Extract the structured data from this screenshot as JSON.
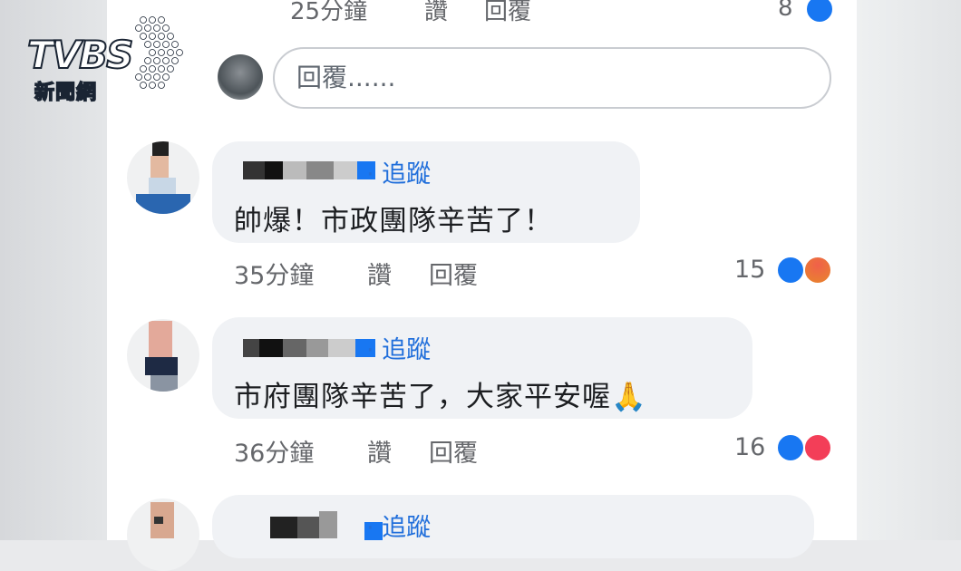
{
  "logo": {
    "brand": "TVBS",
    "sub": "新聞網"
  },
  "top_row": {
    "time": "25分鐘",
    "like_label": "讚",
    "reply_label": "回覆",
    "count": "8"
  },
  "reply_box": {
    "placeholder": "回覆......"
  },
  "comments": [
    {
      "follow": "追蹤",
      "text": "帥爆！市政團隊辛苦了！",
      "time": "35分鐘",
      "like_label": "讚",
      "reply_label": "回覆",
      "reactions_count": "15",
      "reactions": [
        "like-icon",
        "angry-icon"
      ]
    },
    {
      "follow": "追蹤",
      "text": "市府團隊辛苦了，大家平安喔🙏",
      "time": "36分鐘",
      "like_label": "讚",
      "reply_label": "回覆",
      "reactions_count": "16",
      "reactions": [
        "like-icon",
        "love-icon"
      ]
    },
    {
      "follow": "追蹤"
    }
  ],
  "colors": {
    "link": "#216fdb",
    "like": "#1877f2",
    "bubble": "#f0f2f5",
    "muted": "#65676b"
  }
}
